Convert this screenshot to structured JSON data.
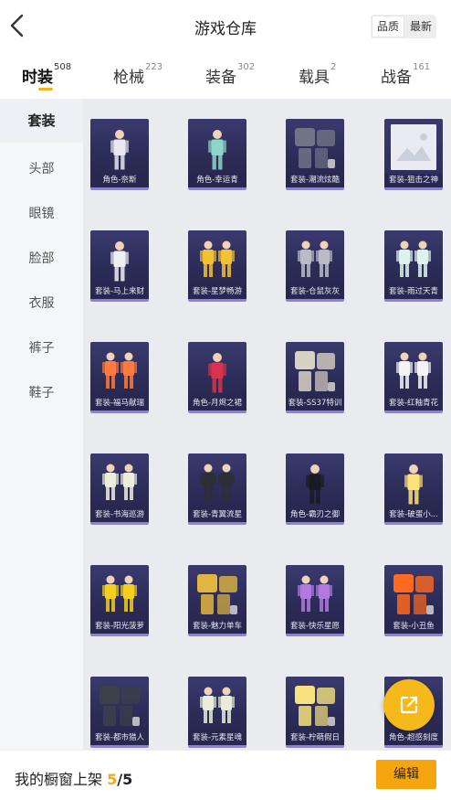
{
  "header": {
    "title": "游戏仓库",
    "sort_options": [
      "品质",
      "最新"
    ],
    "sort_active": "品质",
    "back_icon": "chevron-left-icon"
  },
  "tabs": [
    {
      "label": "时装",
      "count": "508",
      "active": true
    },
    {
      "label": "枪械",
      "count": "223",
      "active": false
    },
    {
      "label": "装备",
      "count": "302",
      "active": false
    },
    {
      "label": "载具",
      "count": "2",
      "active": false
    },
    {
      "label": "战备",
      "count": "161",
      "active": false
    }
  ],
  "sidebar": {
    "items": [
      {
        "label": "套装",
        "active": true
      },
      {
        "label": "头部",
        "active": false
      },
      {
        "label": "眼镜",
        "active": false
      },
      {
        "label": "脸部",
        "active": false
      },
      {
        "label": "衣服",
        "active": false
      },
      {
        "label": "裤子",
        "active": false
      },
      {
        "label": "鞋子",
        "active": false
      }
    ]
  },
  "grid": {
    "items": [
      {
        "label": "角色-奈斯",
        "kind": "single",
        "color": "#e8e8ee"
      },
      {
        "label": "角色-幸运青",
        "kind": "single",
        "color": "#8fd6c8"
      },
      {
        "label": "套装-潮流炫酷",
        "kind": "gear",
        "color": "#6f7486"
      },
      {
        "label": "套装-狙击之神",
        "kind": "placeholder",
        "color": "#e8ebf1"
      },
      {
        "label": "套装-马上来财",
        "kind": "single",
        "color": "#f0f0f0"
      },
      {
        "label": "套装-星梦畅游",
        "kind": "pair",
        "color": "#f2c233"
      },
      {
        "label": "套装-仓鼠灰灰",
        "kind": "pair",
        "color": "#b9bcc4"
      },
      {
        "label": "套装-雨过天青",
        "kind": "pair",
        "color": "#dff3ee"
      },
      {
        "label": "套装-福马献瑞",
        "kind": "pair",
        "color": "#ff7a3c"
      },
      {
        "label": "角色-月烬之裙",
        "kind": "single",
        "color": "#d9334c"
      },
      {
        "label": "套装-SS37特训",
        "kind": "gear",
        "color": "#d8d2c4"
      },
      {
        "label": "套装-红釉青花",
        "kind": "pair",
        "color": "#f4f4f4"
      },
      {
        "label": "套装-书海巡游",
        "kind": "pair",
        "color": "#eeeedd"
      },
      {
        "label": "套装-青翼流星",
        "kind": "pair",
        "color": "#2e2e36"
      },
      {
        "label": "角色-霸刃之御",
        "kind": "single",
        "color": "#1a1a22"
      },
      {
        "label": "套装-破蛋小...",
        "kind": "single",
        "color": "#ffe27a"
      },
      {
        "label": "套装-阳光菠萝",
        "kind": "pair",
        "color": "#f5cf1e"
      },
      {
        "label": "套装-魅力单车",
        "kind": "gear",
        "color": "#e0b640"
      },
      {
        "label": "套装-快乐星愿",
        "kind": "pair",
        "color": "#b07ae0"
      },
      {
        "label": "套装-小丑鱼",
        "kind": "gear",
        "color": "#ff6a1f"
      },
      {
        "label": "套装-都市猎人",
        "kind": "gear",
        "color": "#3c4048"
      },
      {
        "label": "套装-元素星魂",
        "kind": "pair",
        "color": "#e8ecd8"
      },
      {
        "label": "套装-柠萌假日",
        "kind": "gear",
        "color": "#f7e27e"
      },
      {
        "label": "角色-超感刻度",
        "kind": "single",
        "color": "#c9c9d6"
      }
    ]
  },
  "fab": {
    "icon": "share-icon"
  },
  "footer": {
    "showcase_label": "我的橱窗上架",
    "showcase_current": "5",
    "showcase_sep": "/",
    "showcase_total": "5",
    "edit_label": "编辑"
  },
  "colors": {
    "accent": "#f5a60e",
    "tab_underline": "#f2b21b",
    "card_bg": "#2c2c58",
    "card_border": "#8b7fe0"
  }
}
